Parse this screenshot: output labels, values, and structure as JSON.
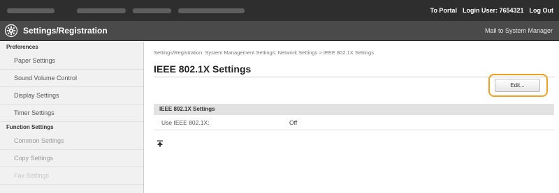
{
  "topbar": {
    "to_portal": "To Portal",
    "login_user": "Login User: 7654321",
    "log_out": "Log Out"
  },
  "header": {
    "title": "Settings/Registration",
    "mail": "Mail to System Manager",
    "icon": "gear-icon"
  },
  "sidebar": {
    "sections": [
      {
        "title": "Preferences",
        "items": [
          {
            "label": "Paper Settings"
          },
          {
            "label": "Sound Volume Control"
          },
          {
            "label": "Display Settings"
          },
          {
            "label": "Timer Settings"
          }
        ]
      },
      {
        "title": "Function Settings",
        "items": [
          {
            "label": "Common Settings"
          },
          {
            "label": "Copy Settings"
          },
          {
            "label": "Fax Settings"
          }
        ]
      }
    ]
  },
  "main": {
    "breadcrumb": "Settings/Registration: System Management Settings: Network Settings > IEEE 802.1X Settings",
    "title": "IEEE 802.1X Settings",
    "edit_label": "Edit...",
    "section_title": "IEEE 802.1X Settings",
    "rows": [
      {
        "label": "Use IEEE 802.1X:",
        "value": "Off"
      }
    ]
  },
  "colors": {
    "highlight": "#f0a020",
    "topbar": "#2e2e2e",
    "titlebar": "#4a4a4a"
  }
}
